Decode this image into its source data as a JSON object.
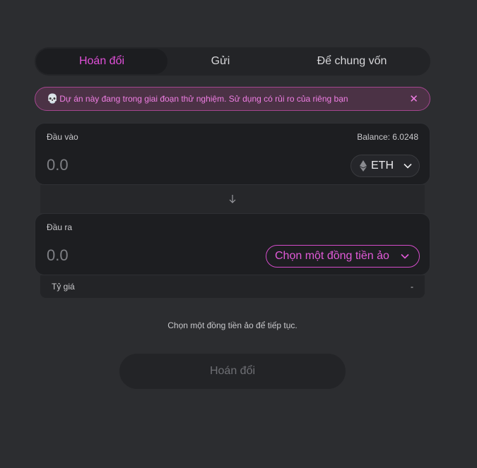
{
  "tabs": [
    {
      "label": "Hoán đổi"
    },
    {
      "label": "Gửi"
    },
    {
      "label": "Để chung vốn"
    }
  ],
  "banner": {
    "text": "Dự án này đang trong giai đoạn thử nghiệm. Sử dụng có rủi ro của riêng bạn",
    "icon": "skull-icon",
    "close_icon": "close-icon"
  },
  "input": {
    "label": "Đầu vào",
    "balance": "Balance: 6.0248",
    "placeholder": "0.0",
    "token": "ETH"
  },
  "output": {
    "label": "Đầu ra",
    "placeholder": "0.0",
    "token_select": "Chọn một đồng tiền ảo"
  },
  "rate": {
    "label": "Tỷ giá",
    "value": "-"
  },
  "hint": "Chọn một đồng tiền ảo để tiếp tục.",
  "swap_button": "Hoán đổi",
  "colors": {
    "accent": "#e04fd8",
    "background": "#2c2d30",
    "card": "#1d1e21"
  }
}
